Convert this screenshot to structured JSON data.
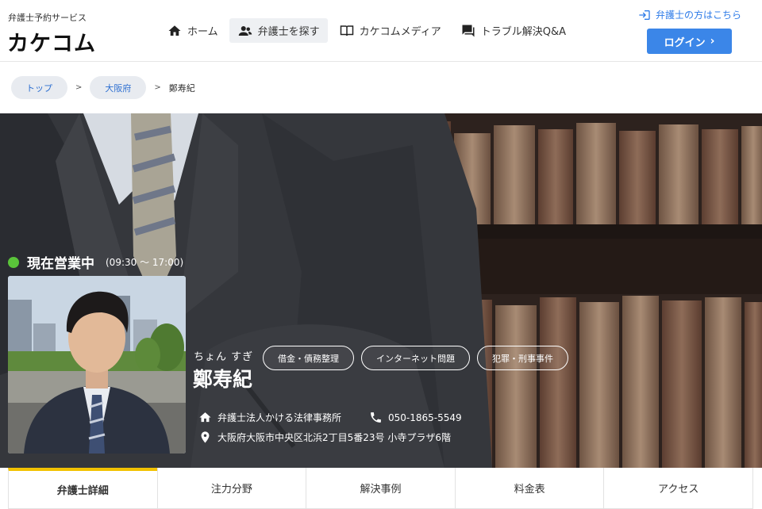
{
  "header": {
    "brand_sub": "弁護士予約サービス",
    "logo": "カケコム",
    "nav": [
      {
        "label": "ホーム",
        "icon": "home-icon"
      },
      {
        "label": "弁護士を探す",
        "icon": "people-icon"
      },
      {
        "label": "カケコムメディア",
        "icon": "book-icon"
      },
      {
        "label": "トラブル解決Q&A",
        "icon": "chat-icon"
      }
    ],
    "lawyer_link": "弁護士の方はこちら",
    "login_label": "ログイン"
  },
  "breadcrumb": {
    "items": [
      "トップ",
      "大阪府"
    ],
    "separator": ">",
    "current": "鄭寿紀"
  },
  "profile": {
    "status_label": "現在営業中",
    "hours": "(09:30 〜 17:00)",
    "kana": "ちょん すぎ",
    "name": "鄭寿紀",
    "tags": [
      "借金・債務整理",
      "インターネット問題",
      "犯罪・刑事事件"
    ],
    "firm": "弁護士法人かける法律事務所",
    "phone": "050-1865-5549",
    "address": "大阪府大阪市中央区北浜2丁目5番23号 小寺プラザ6階",
    "status_color": "#5ac43a"
  },
  "tabs": [
    "弁護士詳細",
    "注力分野",
    "解決事例",
    "料金表",
    "アクセス"
  ],
  "colors": {
    "accent": "#3b86e8",
    "tab_active": "#f2c200",
    "logo_mark": "#f5c400"
  }
}
